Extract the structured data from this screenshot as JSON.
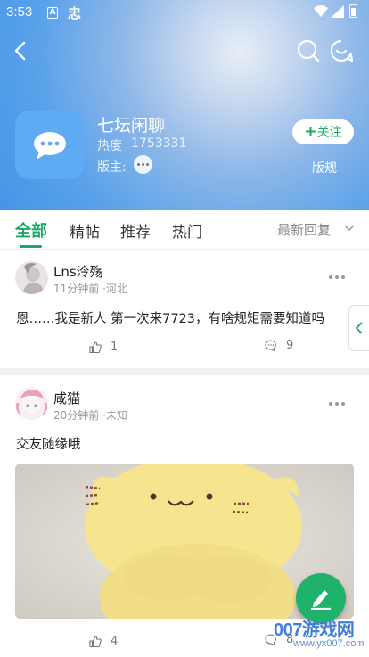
{
  "status_bar": {
    "time": "3:53",
    "icon_a": "A",
    "icon_b": "忠"
  },
  "header": {
    "forum_name": "七坛闲聊",
    "heat_label": "热度",
    "heat_value": "1753331",
    "moderator_label": "版主:",
    "follow_label": "关注",
    "follow_plus": "+",
    "rules_label": "版规"
  },
  "tabs": {
    "items": [
      "全部",
      "精帖",
      "推荐",
      "热门"
    ],
    "active": "全部",
    "sort_label": "最新回复"
  },
  "posts": [
    {
      "user": "Lns泠殇",
      "meta": "11分钟前 ·河北",
      "text": "恩……我是新人 第一次来7723，有啥规矩需要知道吗",
      "likes": "1",
      "comments": "9"
    },
    {
      "user": "咸猫",
      "meta": "20分钟前 ·未知",
      "text": "交友随缘哦",
      "likes": "4",
      "comments": "8"
    }
  ],
  "watermark": {
    "text": "007游戏网",
    "url": "www.yx007.com"
  },
  "colors": {
    "accent": "#1aa864",
    "fab": "#1fb26a",
    "header_blue": "#4595e6"
  },
  "icons": [
    "back-arrow-icon",
    "search-icon",
    "smile-chat-icon",
    "chat-bubble-icon",
    "thumbs-up-icon",
    "comment-icon",
    "edit-pencil-icon",
    "chevron-left-icon",
    "chevron-down-icon"
  ]
}
